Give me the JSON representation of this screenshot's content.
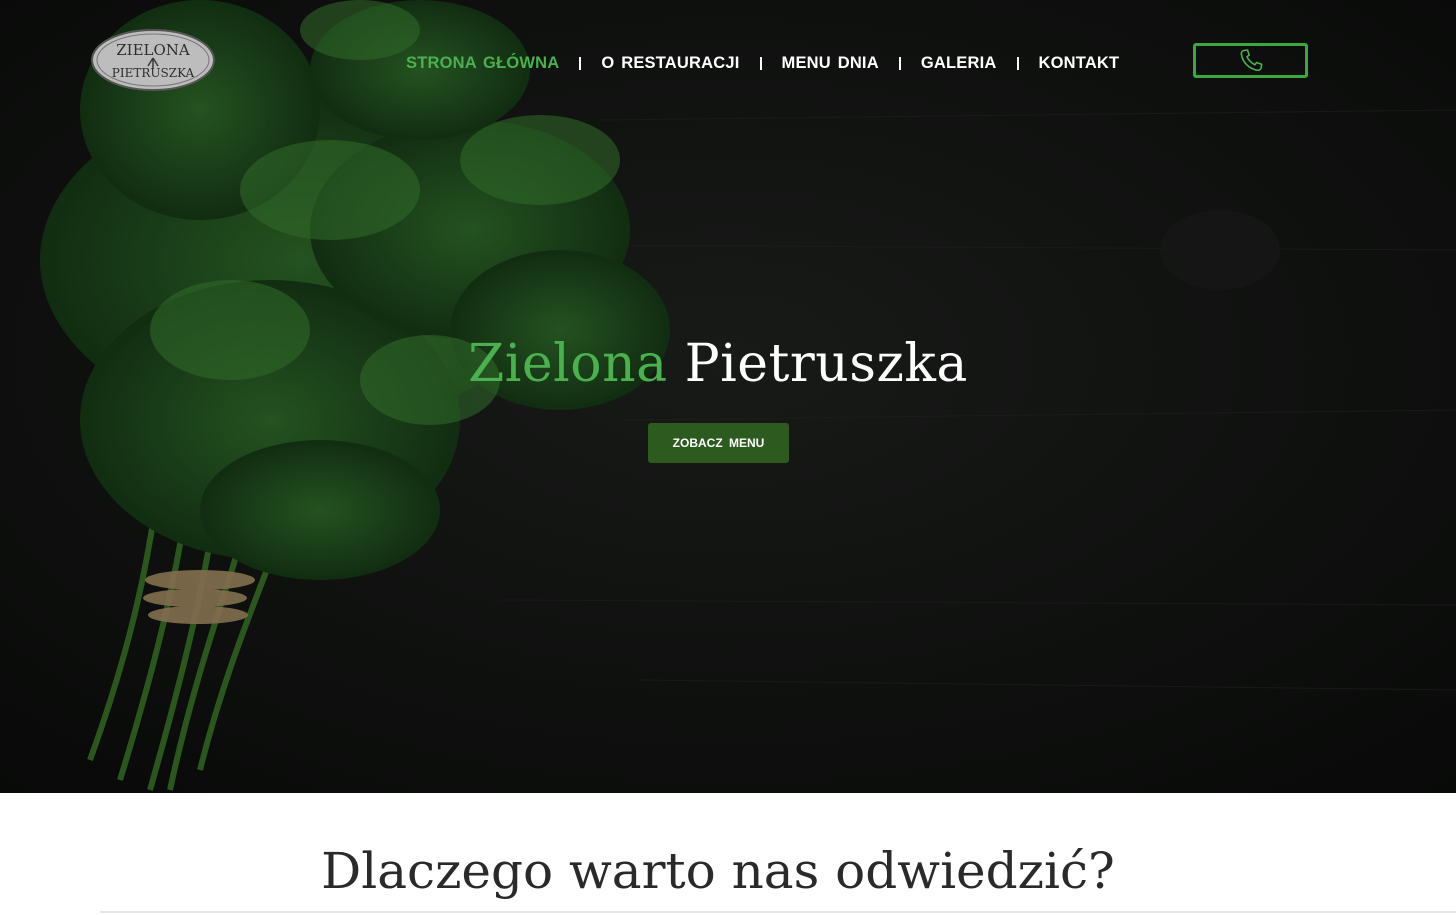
{
  "header": {
    "logo": {
      "line1": "ZIELONA",
      "line2": "PIETRUSZKA"
    },
    "nav": [
      {
        "label": "STRONA GŁÓWNA",
        "active": true
      },
      {
        "label": "O RESTAURACJI",
        "active": false
      },
      {
        "label": "MENU DNIA",
        "active": false
      },
      {
        "label": "GALERIA",
        "active": false
      },
      {
        "label": "KONTAKT",
        "active": false
      }
    ],
    "phone_icon": "phone-icon"
  },
  "hero": {
    "title_part1": "Zielona",
    "title_part2": "Pietruszka",
    "cta_label": "ZOBACZ MENU",
    "background": "parsley-on-dark-wood"
  },
  "section": {
    "title": "Dlaczego warto nas odwiedzić?"
  },
  "colors": {
    "accent_green": "#4caf50",
    "button_green": "#2d5a1f",
    "hero_dark": "#141614"
  }
}
